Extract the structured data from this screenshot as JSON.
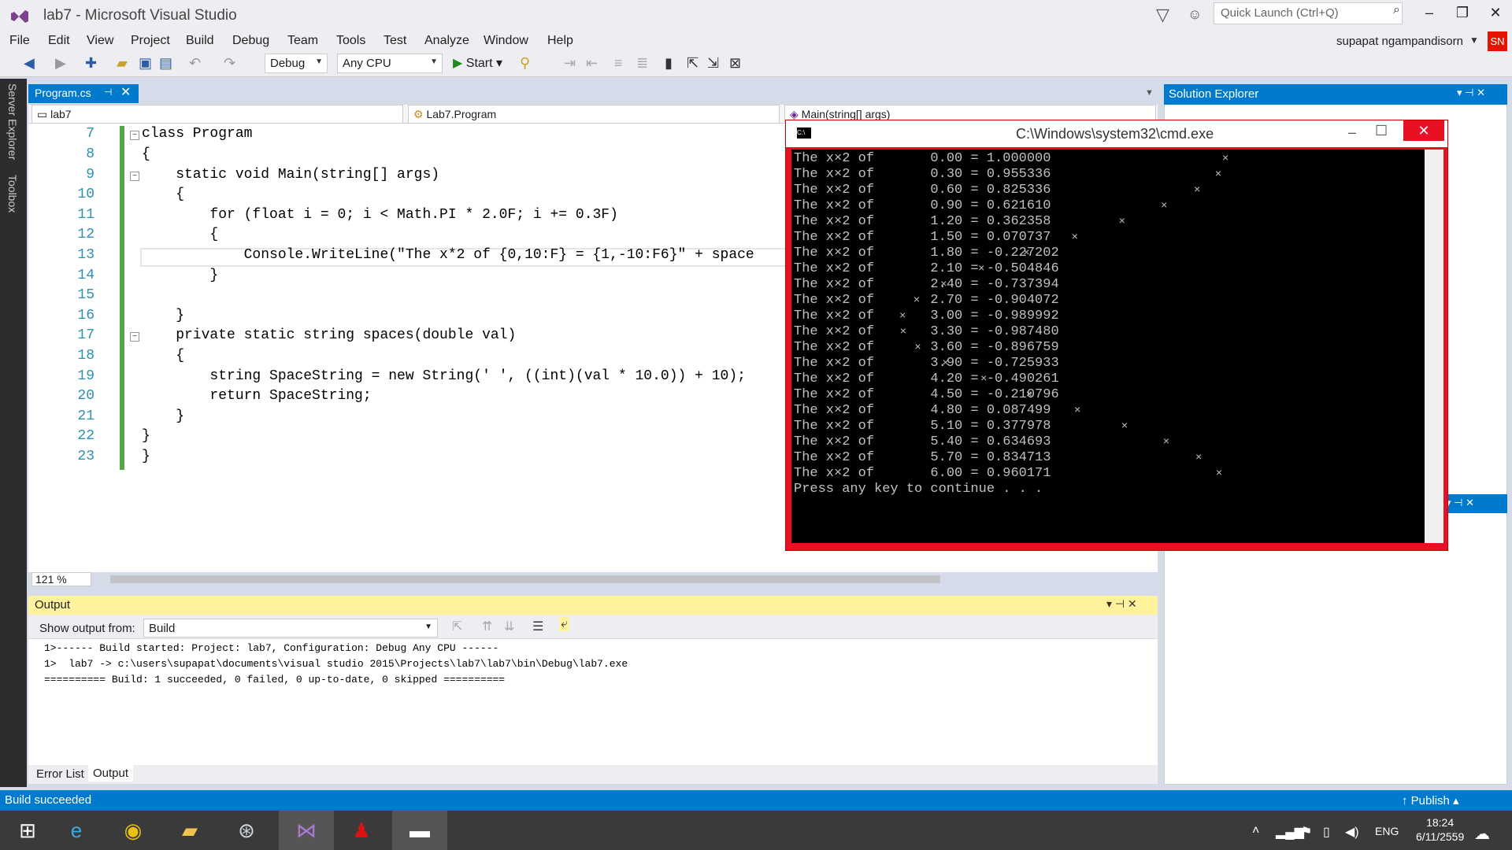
{
  "window": {
    "title": "lab7 - Microsoft Visual Studio",
    "quick_launch_placeholder": "Quick Launch (Ctrl+Q)"
  },
  "menu": [
    "File",
    "Edit",
    "View",
    "Project",
    "Build",
    "Debug",
    "Team",
    "Tools",
    "Test",
    "Analyze",
    "Window",
    "Help"
  ],
  "user": {
    "name": "supapat ngampandisorn",
    "initials": "SN"
  },
  "toolbar": {
    "config": "Debug",
    "platform": "Any CPU",
    "start_label": "Start"
  },
  "side_tabs": [
    "Server Explorer",
    "Toolbox"
  ],
  "editor": {
    "tab_label": "Program.cs",
    "nav_project": "lab7",
    "nav_class": "Lab7.Program",
    "nav_member": "Main(string[] args)",
    "zoom": "121 %",
    "lines": [
      {
        "n": "7",
        "code": "class Program"
      },
      {
        "n": "8",
        "code": "{"
      },
      {
        "n": "9",
        "code": "    static void Main(string[] args)"
      },
      {
        "n": "10",
        "code": "    {"
      },
      {
        "n": "11",
        "code": "        for (float i = 0; i < Math.PI * 2.0F; i += 0.3F)"
      },
      {
        "n": "12",
        "code": "        {"
      },
      {
        "n": "13",
        "code": "            Console.WriteLine(\"The x*2 of {0,10:F} = {1,-10:F6}\" + space"
      },
      {
        "n": "14",
        "code": "        }"
      },
      {
        "n": "15",
        "code": ""
      },
      {
        "n": "16",
        "code": "    }"
      },
      {
        "n": "17",
        "code": "    private static string spaces(double val)"
      },
      {
        "n": "18",
        "code": "    {"
      },
      {
        "n": "19",
        "code": "        string SpaceString = new String(' ', ((int)(val * 10.0)) + 10);"
      },
      {
        "n": "20",
        "code": "        return SpaceString;"
      },
      {
        "n": "21",
        "code": "    }"
      },
      {
        "n": "22",
        "code": "}"
      },
      {
        "n": "23",
        "code": "}"
      }
    ]
  },
  "cmd": {
    "title": "C:\\Windows\\system32\\cmd.exe",
    "lines": [
      "The x×2 of       0.00 = 1.000000",
      "The x×2 of       0.30 = 0.955336",
      "The x×2 of       0.60 = 0.825336",
      "The x×2 of       0.90 = 0.621610",
      "The x×2 of       1.20 = 0.362358",
      "The x×2 of       1.50 = 0.070737",
      "The x×2 of       1.80 = -0.227202",
      "The x×2 of       2.10 = -0.504846",
      "The x×2 of       2.40 = -0.737394",
      "The x×2 of       2.70 = -0.904072",
      "The x×2 of       3.00 = -0.989992",
      "The x×2 of       3.30 = -0.987480",
      "The x×2 of       3.60 = -0.896759",
      "The x×2 of       3.90 = -0.725933",
      "The x×2 of       4.20 = -0.490261",
      "The x×2 of       4.50 = -0.210796",
      "The x×2 of       4.80 = 0.087499",
      "The x×2 of       5.10 = 0.377978",
      "The x×2 of       5.40 = 0.634693",
      "The x×2 of       5.70 = 0.834713",
      "The x×2 of       6.00 = 0.960171"
    ],
    "marker": "×",
    "press_key": "Press any key to continue . . ."
  },
  "solution_explorer": {
    "title": "Solution Explorer"
  },
  "output": {
    "title": "Output",
    "show_from_label": "Show output from:",
    "source": "Build",
    "lines": [
      "1>------ Build started: Project: lab7, Configuration: Debug Any CPU ------",
      "1>  lab7 -> c:\\users\\supapat\\documents\\visual studio 2015\\Projects\\lab7\\lab7\\bin\\Debug\\lab7.exe",
      "========== Build: 1 succeeded, 0 failed, 0 up-to-date, 0 skipped =========="
    ],
    "tabs": [
      "Error List",
      "Output"
    ]
  },
  "status": {
    "text": "Build succeeded",
    "publish": "Publish"
  },
  "taskbar": {
    "time": "18:24",
    "date": "6/11/2559",
    "lang": "ENG"
  }
}
